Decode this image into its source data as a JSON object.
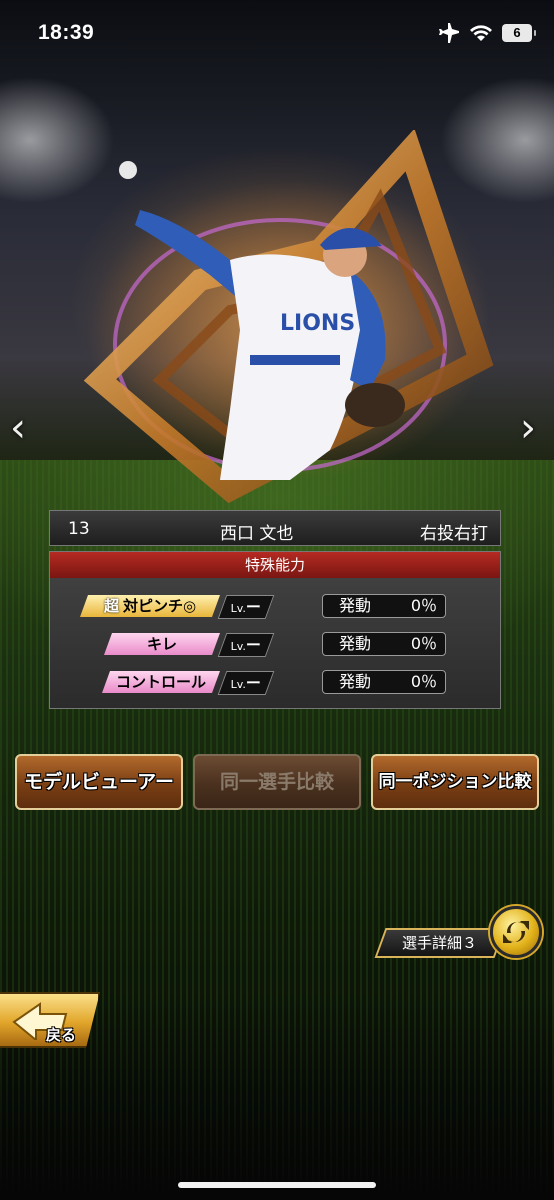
{
  "status_bar": {
    "time": "18:39",
    "battery": "6",
    "icons": [
      "airplane-icon",
      "wifi-icon",
      "battery-icon"
    ]
  },
  "player": {
    "number": "13",
    "name": "西口 文也",
    "throw_bat": "右投右打"
  },
  "abilities": {
    "header": "特殊能力",
    "items": [
      {
        "super_badge": "超",
        "name": "対ピンチ◎",
        "lv_label": "Lv.",
        "lv_value": "ー",
        "trigger_label": "発動",
        "trigger_value": "0％",
        "color": "#f2c64a"
      },
      {
        "name": "キレ",
        "lv_label": "Lv.",
        "lv_value": "ー",
        "trigger_label": "発動",
        "trigger_value": "0％",
        "color": "#f3a6d8"
      },
      {
        "name": "コントロール",
        "lv_label": "Lv.",
        "lv_value": "ー",
        "trigger_label": "発動",
        "trigger_value": "0％",
        "color": "#f3a6d8"
      }
    ]
  },
  "buttons": {
    "model_viewer": "モデルビューアー",
    "same_player_compare": "同一選手比較",
    "same_position_compare": "同一ポジション比較"
  },
  "detail_tab": "選手詳細３",
  "back_label": "戻る",
  "colors": {
    "accent_gold": "#e1a52a",
    "header_red": "#b52a22",
    "button_brown": "#7a3f14"
  }
}
